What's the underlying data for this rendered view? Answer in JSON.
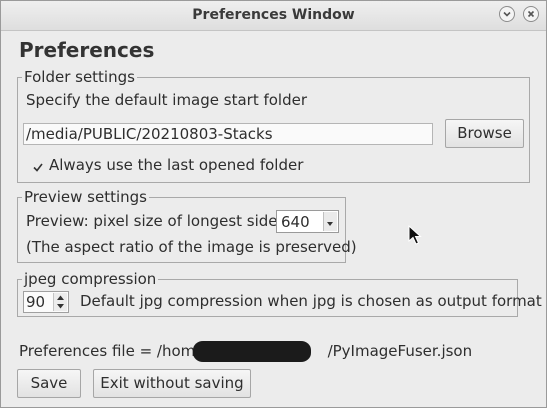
{
  "window": {
    "title": "Preferences Window",
    "controls": [
      "minimize",
      "close"
    ]
  },
  "heading": "Preferences",
  "folder_settings": {
    "legend": "Folder settings",
    "description": "Specify the default image start folder",
    "folder_value": "/media/PUBLIC/20210803-Stacks",
    "browse_label": "Browse",
    "checkbox_label": "Always use the last opened folder",
    "checkbox_checked": true
  },
  "preview_settings": {
    "legend": "Preview settings",
    "pixel_size_label": "Preview: pixel size of longest side",
    "pixel_size_value": "640",
    "aspect_note": "(The aspect ratio of the image is preserved)"
  },
  "jpeg_compression": {
    "legend": "jpeg compression",
    "value": "90",
    "description": "Default jpg compression when jpg is chosen as output format"
  },
  "preferences_file": {
    "prefix": "Preferences file = /home/",
    "suffix": "/PyImageFuser.json"
  },
  "buttons": {
    "save": "Save",
    "exit": "Exit without saving"
  }
}
